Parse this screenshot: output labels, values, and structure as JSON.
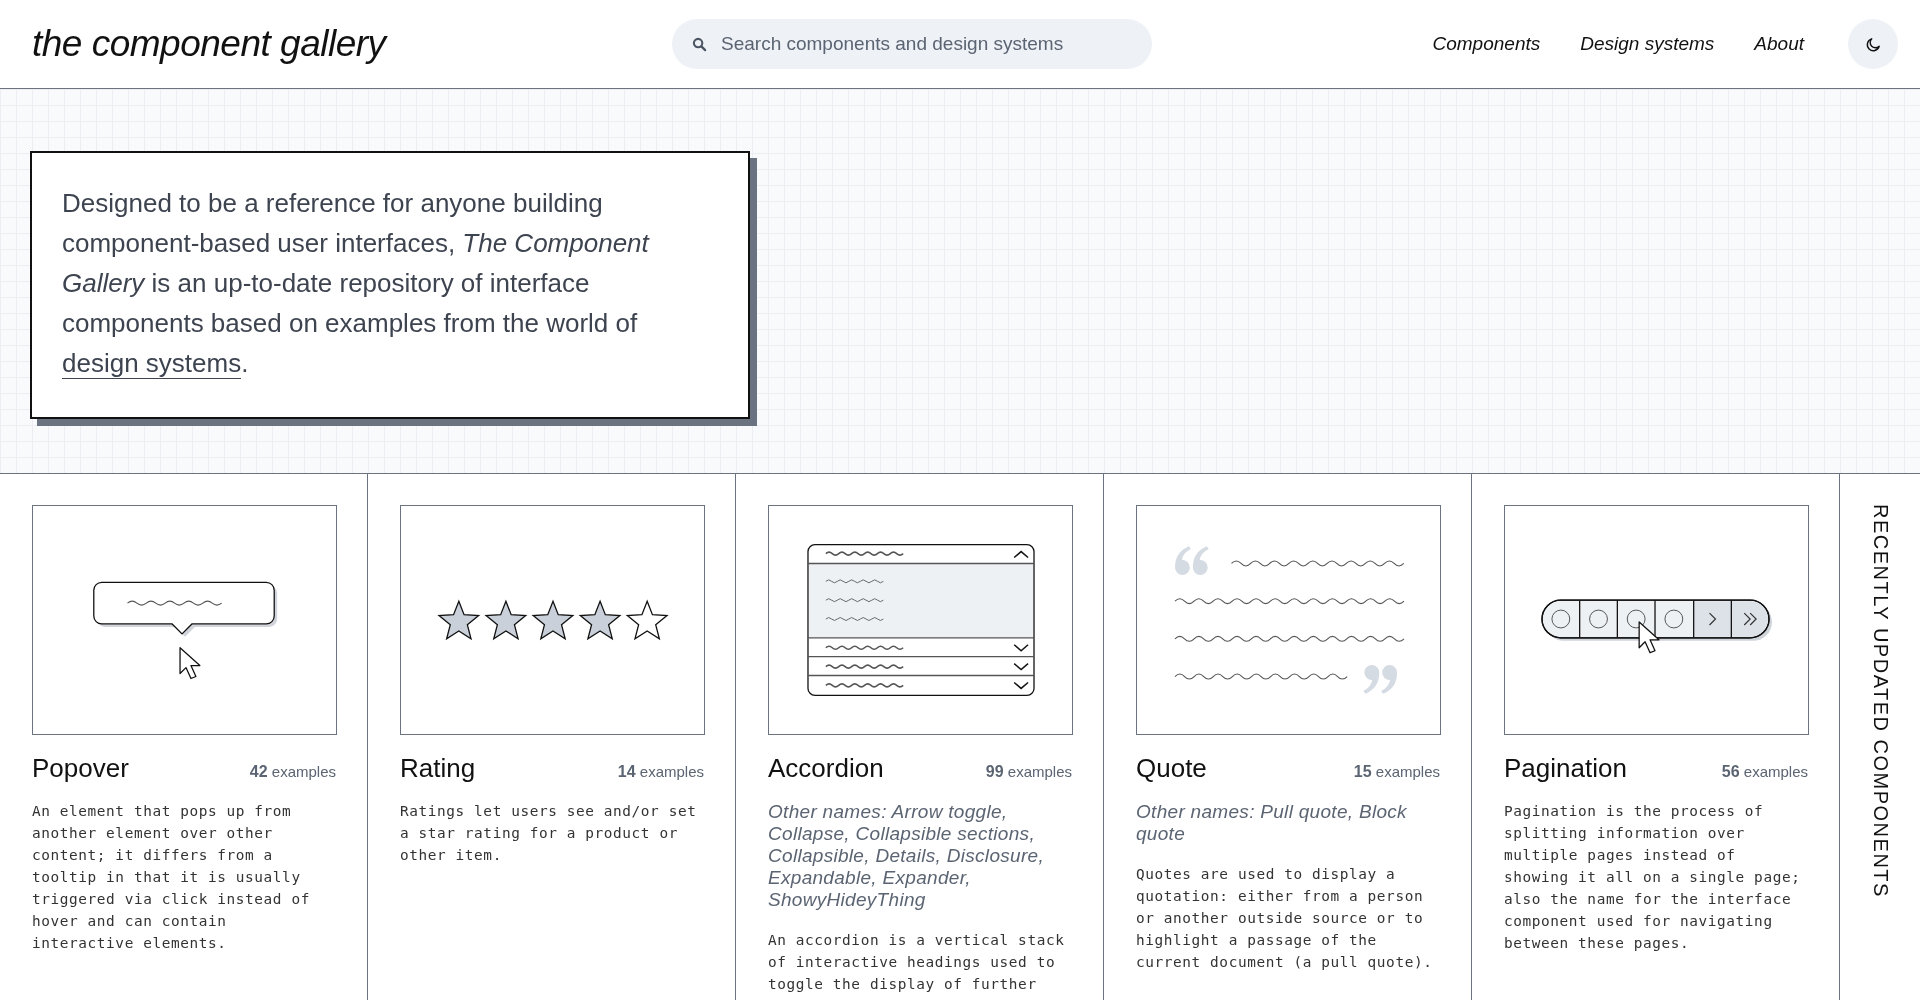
{
  "header": {
    "logo": "the component gallery",
    "search": {
      "placeholder": "Search components and design systems"
    },
    "nav": [
      {
        "label": "Components"
      },
      {
        "label": "Design systems"
      },
      {
        "label": "About"
      }
    ]
  },
  "intro": {
    "text": "Designed to be a reference for anyone building component-based user interfaces, *The Component Gallery* is an up-to-date repository of interface components based on examples from the world of ",
    "link": "design systems",
    "after": "."
  },
  "cards": [
    {
      "kind": "popover",
      "title": "Popover",
      "count": "42",
      "count_label": "examples",
      "description": "An element that pops up from another element over other content; it differs from a tooltip in that it is usually triggered via click instead of hover and can contain interactive elements."
    },
    {
      "kind": "rating",
      "stars": 4,
      "title": "Rating",
      "count": "14",
      "count_label": "examples",
      "description": "Ratings let users see and/or set a star rating for a product or other item."
    },
    {
      "kind": "accordion",
      "title": "Accordion",
      "count": "99",
      "count_label": "examples",
      "other_names": "Other names: Arrow toggle, Collapse, Collapsible sections, Collapsible, Details, Disclosure, Expandable, Expander, ShowyHideyThing",
      "description": "An accordion is a vertical stack of interactive headings used to toggle the display of further"
    },
    {
      "kind": "quote",
      "title": "Quote",
      "count": "15",
      "count_label": "examples",
      "other_names": "Other names: Pull quote, Block quote",
      "description": "Quotes are used to display a quotation: either from a person or another outside source or to highlight a passage of the current document (a pull quote)."
    },
    {
      "kind": "pagination",
      "title": "Pagination",
      "count": "56",
      "count_label": "examples",
      "description": "Pagination is the process of splitting information over multiple pages instead of showing it all on a single page; also the name for the interface component used for navigating between these pages."
    }
  ],
  "side_label": "RECENTLY UPDATED COMPONENTS"
}
